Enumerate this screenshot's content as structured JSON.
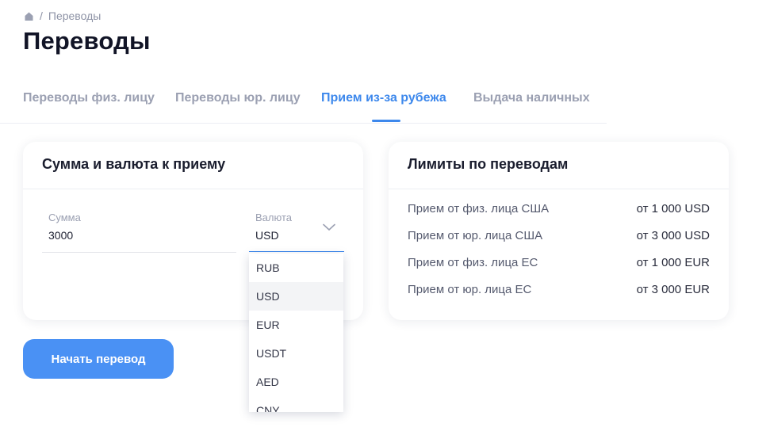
{
  "breadcrumb": {
    "separator": "/",
    "current": "Переводы"
  },
  "page": {
    "title": "Переводы"
  },
  "tabs": [
    {
      "label": "Переводы физ. лицу",
      "active": false
    },
    {
      "label": "Переводы юр. лицу",
      "active": false
    },
    {
      "label": "Прием из-за рубежа",
      "active": true
    },
    {
      "label": "Выдача наличных",
      "active": false
    }
  ],
  "amount_card": {
    "title": "Сумма и валюта к приему",
    "amount_label": "Сумма",
    "amount_value": "3000",
    "currency_label": "Валюта",
    "currency_value": "USD",
    "currency_options": [
      "RUB",
      "USD",
      "EUR",
      "USDT",
      "AED",
      "CNY"
    ],
    "selected_option": "USD"
  },
  "limits_card": {
    "title": "Лимиты по переводам",
    "rows": [
      {
        "label": "Прием от физ. лица США",
        "value": "от 1 000 USD"
      },
      {
        "label": "Прием от юр. лица США",
        "value": "от 3 000 USD"
      },
      {
        "label": "Прием от физ. лица ЕС",
        "value": "от 1 000 EUR"
      },
      {
        "label": "Прием от юр. лица ЕС",
        "value": "от 3 000 EUR"
      }
    ]
  },
  "actions": {
    "start_label": "Начать перевод"
  },
  "colors": {
    "accent": "#3d88ec",
    "button": "#4a91f4",
    "muted": "#9ba0b2"
  }
}
